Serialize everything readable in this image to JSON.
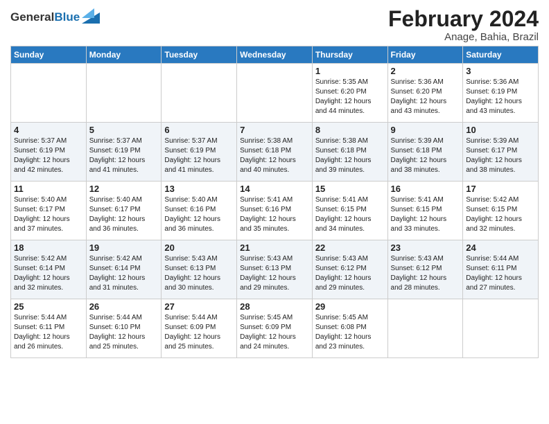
{
  "logo": {
    "text_general": "General",
    "text_blue": "Blue"
  },
  "header": {
    "month_year": "February 2024",
    "location": "Anage, Bahia, Brazil"
  },
  "days_of_week": [
    "Sunday",
    "Monday",
    "Tuesday",
    "Wednesday",
    "Thursday",
    "Friday",
    "Saturday"
  ],
  "weeks": [
    [
      {
        "day": "",
        "info": ""
      },
      {
        "day": "",
        "info": ""
      },
      {
        "day": "",
        "info": ""
      },
      {
        "day": "",
        "info": ""
      },
      {
        "day": "1",
        "info": "Sunrise: 5:35 AM\nSunset: 6:20 PM\nDaylight: 12 hours\nand 44 minutes."
      },
      {
        "day": "2",
        "info": "Sunrise: 5:36 AM\nSunset: 6:20 PM\nDaylight: 12 hours\nand 43 minutes."
      },
      {
        "day": "3",
        "info": "Sunrise: 5:36 AM\nSunset: 6:19 PM\nDaylight: 12 hours\nand 43 minutes."
      }
    ],
    [
      {
        "day": "4",
        "info": "Sunrise: 5:37 AM\nSunset: 6:19 PM\nDaylight: 12 hours\nand 42 minutes."
      },
      {
        "day": "5",
        "info": "Sunrise: 5:37 AM\nSunset: 6:19 PM\nDaylight: 12 hours\nand 41 minutes."
      },
      {
        "day": "6",
        "info": "Sunrise: 5:37 AM\nSunset: 6:19 PM\nDaylight: 12 hours\nand 41 minutes."
      },
      {
        "day": "7",
        "info": "Sunrise: 5:38 AM\nSunset: 6:18 PM\nDaylight: 12 hours\nand 40 minutes."
      },
      {
        "day": "8",
        "info": "Sunrise: 5:38 AM\nSunset: 6:18 PM\nDaylight: 12 hours\nand 39 minutes."
      },
      {
        "day": "9",
        "info": "Sunrise: 5:39 AM\nSunset: 6:18 PM\nDaylight: 12 hours\nand 38 minutes."
      },
      {
        "day": "10",
        "info": "Sunrise: 5:39 AM\nSunset: 6:17 PM\nDaylight: 12 hours\nand 38 minutes."
      }
    ],
    [
      {
        "day": "11",
        "info": "Sunrise: 5:40 AM\nSunset: 6:17 PM\nDaylight: 12 hours\nand 37 minutes."
      },
      {
        "day": "12",
        "info": "Sunrise: 5:40 AM\nSunset: 6:17 PM\nDaylight: 12 hours\nand 36 minutes."
      },
      {
        "day": "13",
        "info": "Sunrise: 5:40 AM\nSunset: 6:16 PM\nDaylight: 12 hours\nand 36 minutes."
      },
      {
        "day": "14",
        "info": "Sunrise: 5:41 AM\nSunset: 6:16 PM\nDaylight: 12 hours\nand 35 minutes."
      },
      {
        "day": "15",
        "info": "Sunrise: 5:41 AM\nSunset: 6:15 PM\nDaylight: 12 hours\nand 34 minutes."
      },
      {
        "day": "16",
        "info": "Sunrise: 5:41 AM\nSunset: 6:15 PM\nDaylight: 12 hours\nand 33 minutes."
      },
      {
        "day": "17",
        "info": "Sunrise: 5:42 AM\nSunset: 6:15 PM\nDaylight: 12 hours\nand 32 minutes."
      }
    ],
    [
      {
        "day": "18",
        "info": "Sunrise: 5:42 AM\nSunset: 6:14 PM\nDaylight: 12 hours\nand 32 minutes."
      },
      {
        "day": "19",
        "info": "Sunrise: 5:42 AM\nSunset: 6:14 PM\nDaylight: 12 hours\nand 31 minutes."
      },
      {
        "day": "20",
        "info": "Sunrise: 5:43 AM\nSunset: 6:13 PM\nDaylight: 12 hours\nand 30 minutes."
      },
      {
        "day": "21",
        "info": "Sunrise: 5:43 AM\nSunset: 6:13 PM\nDaylight: 12 hours\nand 29 minutes."
      },
      {
        "day": "22",
        "info": "Sunrise: 5:43 AM\nSunset: 6:12 PM\nDaylight: 12 hours\nand 29 minutes."
      },
      {
        "day": "23",
        "info": "Sunrise: 5:43 AM\nSunset: 6:12 PM\nDaylight: 12 hours\nand 28 minutes."
      },
      {
        "day": "24",
        "info": "Sunrise: 5:44 AM\nSunset: 6:11 PM\nDaylight: 12 hours\nand 27 minutes."
      }
    ],
    [
      {
        "day": "25",
        "info": "Sunrise: 5:44 AM\nSunset: 6:11 PM\nDaylight: 12 hours\nand 26 minutes."
      },
      {
        "day": "26",
        "info": "Sunrise: 5:44 AM\nSunset: 6:10 PM\nDaylight: 12 hours\nand 25 minutes."
      },
      {
        "day": "27",
        "info": "Sunrise: 5:44 AM\nSunset: 6:09 PM\nDaylight: 12 hours\nand 25 minutes."
      },
      {
        "day": "28",
        "info": "Sunrise: 5:45 AM\nSunset: 6:09 PM\nDaylight: 12 hours\nand 24 minutes."
      },
      {
        "day": "29",
        "info": "Sunrise: 5:45 AM\nSunset: 6:08 PM\nDaylight: 12 hours\nand 23 minutes."
      },
      {
        "day": "",
        "info": ""
      },
      {
        "day": "",
        "info": ""
      }
    ]
  ]
}
